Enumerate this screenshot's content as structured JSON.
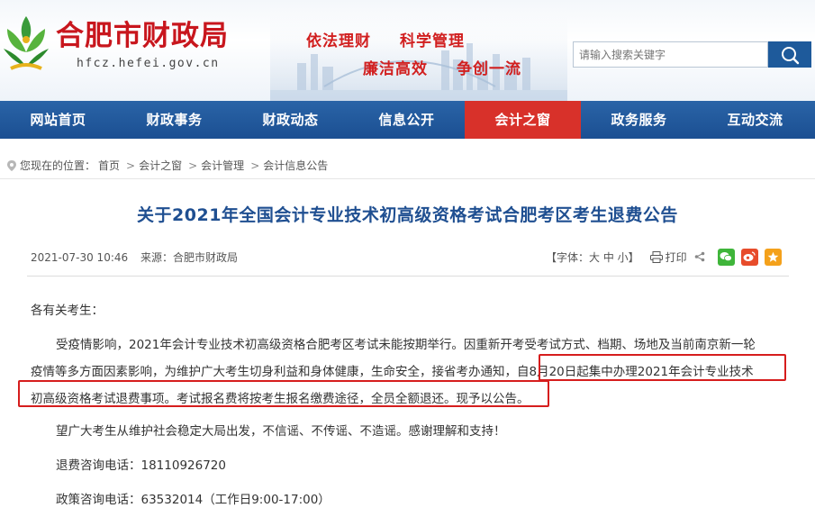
{
  "header": {
    "site_title": "合肥市财政局",
    "site_url": "hfcz.hefei.gov.cn",
    "slogans": [
      "依法理财",
      "科学管理",
      "廉洁高效",
      "争创一流"
    ],
    "search_placeholder": "请输入搜索关键字"
  },
  "nav": {
    "items": [
      {
        "label": "网站首页"
      },
      {
        "label": "财政事务"
      },
      {
        "label": "财政动态"
      },
      {
        "label": "信息公开"
      },
      {
        "label": "会计之窗",
        "active": true
      },
      {
        "label": "政务服务"
      },
      {
        "label": "互动交流"
      }
    ]
  },
  "breadcrumb": {
    "prefix": "您现在的位置：",
    "items": [
      "首页",
      "会计之窗",
      "会计管理",
      "会计信息公告"
    ],
    "separator": ">"
  },
  "article": {
    "title": "关于2021年全国会计专业技术初高级资格考试合肥考区考生退费公告",
    "date": "2021-07-30 10:46",
    "source": "来源：合肥市财政局",
    "font_size_label": "【字体：大 中 小】",
    "print_label": "打印",
    "greeting": "各有关考生：",
    "para1_line1": "受疫情影响，2021年会计专业技术初高级资格合肥考区考试未能按期举行。因重新开考受考试方式、档期、场地及当前南京新一轮",
    "para1_line2": "疫情等多方面因素影响，为维护广大考生切身利益和身体健康，生命安全，接省考办通知，自8月20日起集中办理2021年会计专业技术",
    "para1_line3": "初高级资格考试退费事项。考试报名费将按考生报名缴费途径，全员全额退还。现予以公告。",
    "para2": "望广大考生从维护社会稳定大局出发，不信谣、不传谣、不造谣。感谢理解和支持！",
    "refund_phone": "退费咨询电话：18110926720",
    "policy_phone": "政策咨询电话：63532014（工作日9:00-17:00）"
  },
  "colors": {
    "nav_bg": "#1f5699",
    "nav_active": "#d8312a",
    "title_blue": "#1f4f91",
    "brand_red": "#c8161d",
    "highlight_red": "#d61d1d"
  }
}
